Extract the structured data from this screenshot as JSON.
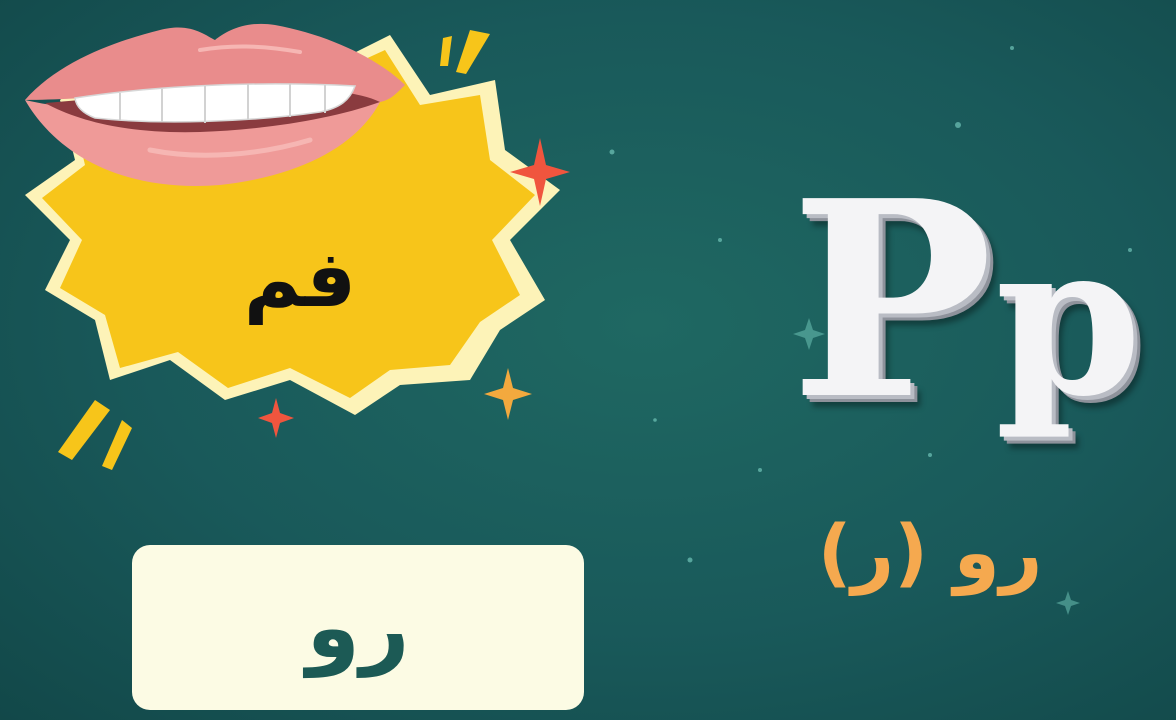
{
  "card": {
    "word": "رو"
  },
  "illustration": {
    "icon": "mouth-icon",
    "word": "فم"
  },
  "letter": {
    "upper": "P",
    "lower": "p",
    "pronunciation": "رو (ر)"
  },
  "colors": {
    "background": "#19595a",
    "burst": "#f7c51a",
    "accent": "#f5a94f",
    "card": "#fcfbe4"
  }
}
